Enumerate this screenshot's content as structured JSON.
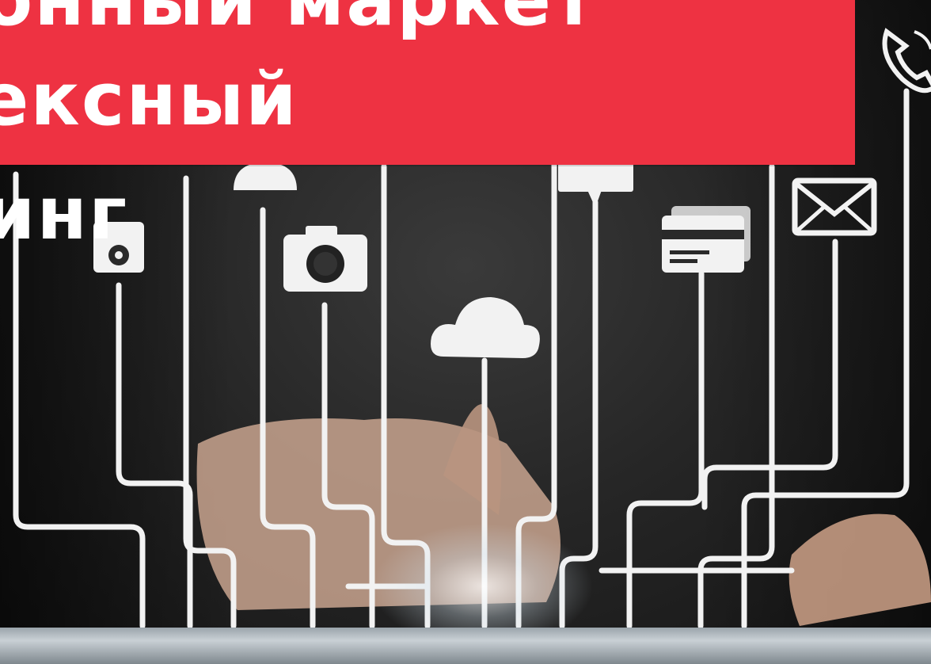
{
  "title": {
    "line1": "онный маркет",
    "line2": "ексный",
    "line3": "инг"
  },
  "icons": [
    "phone-icon",
    "music-player-icon",
    "user-icon",
    "camera-icon",
    "cloud-icon",
    "chat-bubble-icon",
    "credit-card-icon",
    "envelope-icon"
  ],
  "colors": {
    "banner": "#ee3242",
    "title_text": "#ffffff",
    "lines": "#f2f2f2"
  }
}
